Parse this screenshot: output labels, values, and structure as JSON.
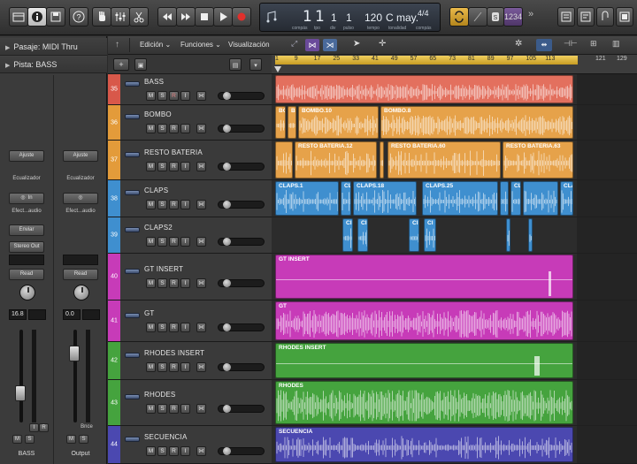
{
  "lcd": {
    "bar": "1",
    "beat": "1",
    "div": "1",
    "tick": "1",
    "bar_lbl": "compás",
    "beat_lbl": "tpo",
    "div_lbl": "div",
    "tick_lbl": "pulso",
    "tempo": "120",
    "tempo_lbl": "tempo",
    "key": "C may.",
    "key_lbl": "tonalidad",
    "sig": "4/4",
    "sig_lbl": "compás"
  },
  "toolbar": {
    "count_in": "1234"
  },
  "inspector": {
    "region_row": "Pasaje:  MIDI Thru",
    "track_row": "Pista: BASS",
    "left": {
      "settings": "Ajuste",
      "eq": "Ecualizador",
      "input": "In",
      "effects": "Efect...audio",
      "send": "Enviar",
      "output": "Stereo Out",
      "automation": "Read",
      "volume": "16.8",
      "mute": "M",
      "solo": "S",
      "input_mon": "I",
      "rec": "R",
      "name": "BASS"
    },
    "right": {
      "settings": "Ajuste",
      "eq": "Ecualizador",
      "effects": "Efect...audio",
      "automation": "Read",
      "volume": "0.0",
      "bounce": "Bnce",
      "mute": "M",
      "solo": "S",
      "name": "Output"
    }
  },
  "menus": {
    "edit": "Edición",
    "functions": "Funciones",
    "view": "Visualización"
  },
  "ruler": {
    "bars": [
      "1",
      "9",
      "17",
      "25",
      "33",
      "41",
      "49",
      "57",
      "65",
      "73",
      "81",
      "89",
      "97",
      "105",
      "113",
      "121",
      "129"
    ]
  },
  "tracks": [
    {
      "num": "35",
      "name": "BASS",
      "color": "#d8584a"
    },
    {
      "num": "36",
      "name": "BOMBO",
      "color": "#e39b3a"
    },
    {
      "num": "37",
      "name": "RESTO BATERIA",
      "color": "#e39b3a"
    },
    {
      "num": "38",
      "name": "CLAPS",
      "color": "#3f8fcf"
    },
    {
      "num": "39",
      "name": "CLAPS2",
      "color": "#3f8fcf"
    },
    {
      "num": "40",
      "name": "GT INSERT",
      "color": "#c73bb8"
    },
    {
      "num": "41",
      "name": "GT",
      "color": "#c73bb8"
    },
    {
      "num": "42",
      "name": "RHODES INSERT",
      "color": "#45a33e"
    },
    {
      "num": "43",
      "name": "RHODES",
      "color": "#45a33e"
    },
    {
      "num": "44",
      "name": "SECUENCIA",
      "color": "#4b48b0"
    }
  ],
  "track_buttons": {
    "mute": "M",
    "solo": "S",
    "rec": "R",
    "input": "I"
  },
  "regions": {
    "bass": "",
    "bombo": [
      "BO",
      "BO",
      "BOMBO.10",
      "BOMBO.8"
    ],
    "resto": [
      "RESTO BATERIA.12",
      "RESTO BATERIA.60",
      "RESTO BATERIA.63"
    ],
    "claps": [
      "CLAPS.1",
      "CL",
      "CLAPS.18",
      "CLAPS.25",
      "CL",
      "CLA"
    ],
    "claps2": [
      "Cl",
      "Cl",
      "Cl",
      "Cl"
    ],
    "gt_insert": "GT INSERT",
    "gt": "GT",
    "rhodes_insert": "RHODES INSERT",
    "rhodes": "RHODES",
    "secuencia": "SECUENCIA"
  },
  "colors": {
    "bass": "#e3705e",
    "bombo": "#e6a24a",
    "resto": "#e6a24a",
    "claps": "#3f8fcf",
    "gt": "#c73bb8",
    "rhodes": "#45a33e",
    "secuencia": "#4b48b0"
  }
}
